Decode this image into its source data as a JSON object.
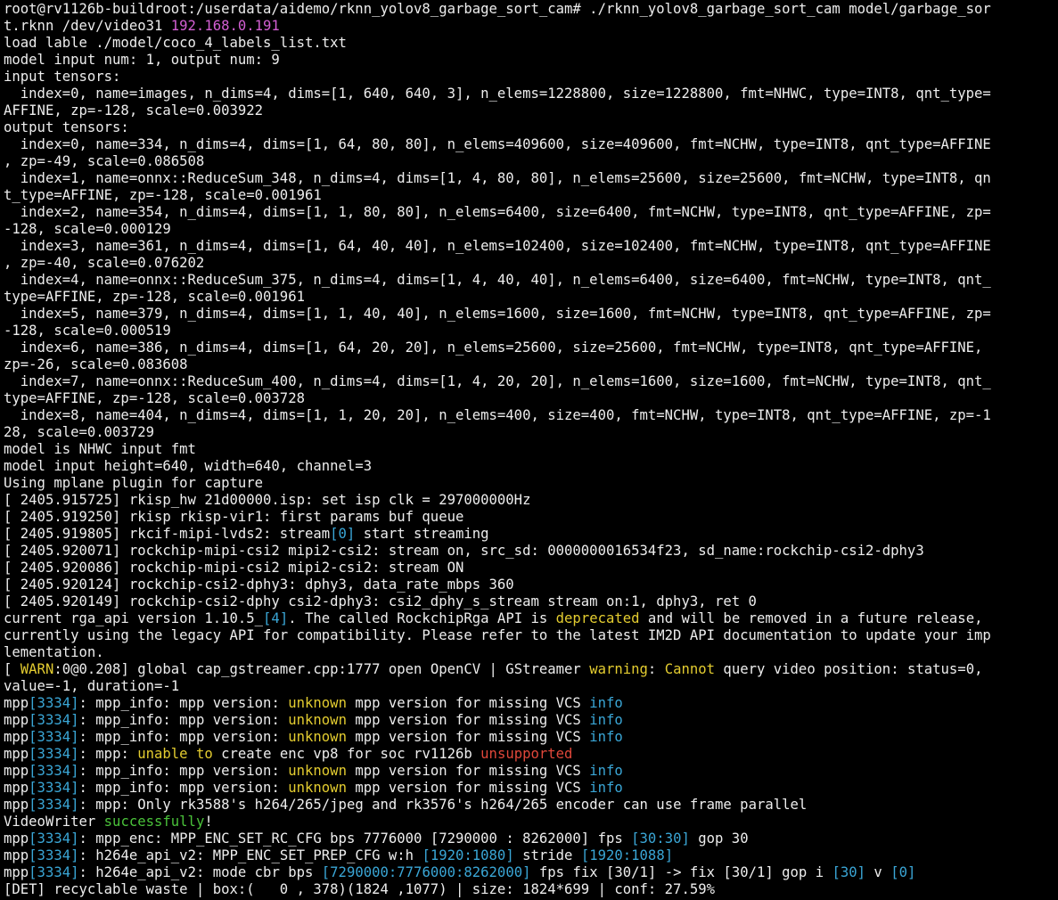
{
  "terminal": {
    "lines": [
      [
        {
          "t": "root@rv1126b-buildroot:/userdata/aidemo/rknn_yolov8_garbage_sort_cam# ./rknn_yolov8_garbage_sort_cam model/garbage_sor"
        }
      ],
      [
        {
          "t": "t.rknn /dev/video31 "
        },
        {
          "t": "192.168.0.191",
          "c": "magenta"
        }
      ],
      [
        {
          "t": "load lable ./model/coco_4_labels_list.txt"
        }
      ],
      [
        {
          "t": "model input num: 1, output num: 9"
        }
      ],
      [
        {
          "t": "input tensors:"
        }
      ],
      [
        {
          "t": "  index=0, name=images, n_dims=4, dims=[1, 640, 640, 3], n_elems=1228800, size=1228800, fmt=NHWC, type=INT8, qnt_type="
        }
      ],
      [
        {
          "t": "AFFINE, zp=-128, scale=0.003922"
        }
      ],
      [
        {
          "t": "output tensors:"
        }
      ],
      [
        {
          "t": "  index=0, name=334, n_dims=4, dims=[1, 64, 80, 80], n_elems=409600, size=409600, fmt=NCHW, type=INT8, qnt_type=AFFINE"
        }
      ],
      [
        {
          "t": ", zp=-49, scale=0.086508"
        }
      ],
      [
        {
          "t": "  index=1, name=onnx::ReduceSum_348, n_dims=4, dims=[1, 4, 80, 80], n_elems=25600, size=25600, fmt=NCHW, type=INT8, qn"
        }
      ],
      [
        {
          "t": "t_type=AFFINE, zp=-128, scale=0.001961"
        }
      ],
      [
        {
          "t": "  index=2, name=354, n_dims=4, dims=[1, 1, 80, 80], n_elems=6400, size=6400, fmt=NCHW, type=INT8, qnt_type=AFFINE, zp="
        }
      ],
      [
        {
          "t": "-128, scale=0.000129"
        }
      ],
      [
        {
          "t": "  index=3, name=361, n_dims=4, dims=[1, 64, 40, 40], n_elems=102400, size=102400, fmt=NCHW, type=INT8, qnt_type=AFFINE"
        }
      ],
      [
        {
          "t": ", zp=-40, scale=0.076202"
        }
      ],
      [
        {
          "t": "  index=4, name=onnx::ReduceSum_375, n_dims=4, dims=[1, 4, 40, 40], n_elems=6400, size=6400, fmt=NCHW, type=INT8, qnt_"
        }
      ],
      [
        {
          "t": "type=AFFINE, zp=-128, scale=0.001961"
        }
      ],
      [
        {
          "t": "  index=5, name=379, n_dims=4, dims=[1, 1, 40, 40], n_elems=1600, size=1600, fmt=NCHW, type=INT8, qnt_type=AFFINE, zp="
        }
      ],
      [
        {
          "t": "-128, scale=0.000519"
        }
      ],
      [
        {
          "t": "  index=6, name=386, n_dims=4, dims=[1, 64, 20, 20], n_elems=25600, size=25600, fmt=NCHW, type=INT8, qnt_type=AFFINE,"
        }
      ],
      [
        {
          "t": "zp=-26, scale=0.083608"
        }
      ],
      [
        {
          "t": "  index=7, name=onnx::ReduceSum_400, n_dims=4, dims=[1, 4, 20, 20], n_elems=1600, size=1600, fmt=NCHW, type=INT8, qnt_"
        }
      ],
      [
        {
          "t": "type=AFFINE, zp=-128, scale=0.003728"
        }
      ],
      [
        {
          "t": "  index=8, name=404, n_dims=4, dims=[1, 1, 20, 20], n_elems=400, size=400, fmt=NCHW, type=INT8, qnt_type=AFFINE, zp=-1"
        }
      ],
      [
        {
          "t": "28, scale=0.003729"
        }
      ],
      [
        {
          "t": "model is NHWC input fmt"
        }
      ],
      [
        {
          "t": "model input height=640, width=640, channel=3"
        }
      ],
      [
        {
          "t": "Using mplane plugin for capture"
        }
      ],
      [
        {
          "t": "[ 2405.915725] rkisp_hw 21d00000.isp: set isp clk = 297000000Hz"
        }
      ],
      [
        {
          "t": "[ 2405.919250] rkisp rkisp-vir1: first params buf queue"
        }
      ],
      [
        {
          "t": "[ 2405.919805] rkcif-mipi-lvds2: stream"
        },
        {
          "t": "[0]",
          "c": "cyan"
        },
        {
          "t": " start streaming"
        }
      ],
      [
        {
          "t": "[ 2405.920071] rockchip-mipi-csi2 mipi2-csi2: stream on, src_sd: 0000000016534f23, sd_name:rockchip-csi2-dphy3"
        }
      ],
      [
        {
          "t": "[ 2405.920086] rockchip-mipi-csi2 mipi2-csi2: stream ON"
        }
      ],
      [
        {
          "t": "[ 2405.920124] rockchip-csi2-dphy3: dphy3, data_rate_mbps 360"
        }
      ],
      [
        {
          "t": "[ 2405.920149] rockchip-csi2-dphy csi2-dphy3: csi2_dphy_s_stream stream on:1, dphy3, ret 0"
        }
      ],
      [
        {
          "t": "current rga_api version 1.10.5_"
        },
        {
          "t": "[4]",
          "c": "cyan"
        },
        {
          "t": ". The called RockchipRga API is "
        },
        {
          "t": "deprecated",
          "c": "yellow"
        },
        {
          "t": " and will be removed in a future release,"
        }
      ],
      [
        {
          "t": "currently using the legacy API for compatibility. Please refer to the latest IM2D API documentation to update your imp"
        }
      ],
      [
        {
          "t": "lementation."
        }
      ],
      [
        {
          "t": "[ "
        },
        {
          "t": "WARN",
          "c": "yellow"
        },
        {
          "t": ":0@0.208] global cap_gstreamer.cpp:1777 open OpenCV | GStreamer "
        },
        {
          "t": "warning",
          "c": "yellow"
        },
        {
          "t": ": "
        },
        {
          "t": "Cannot",
          "c": "yellow"
        },
        {
          "t": " query video position: status=0,"
        }
      ],
      [
        {
          "t": "value=-1, duration=-1"
        }
      ],
      [
        {
          "t": "mpp"
        },
        {
          "t": "[3334]",
          "c": "cyan"
        },
        {
          "t": ": mpp_info: mpp version: "
        },
        {
          "t": "unknown",
          "c": "yellow"
        },
        {
          "t": " mpp version for missing VCS "
        },
        {
          "t": "info",
          "c": "cyan"
        }
      ],
      [
        {
          "t": "mpp"
        },
        {
          "t": "[3334]",
          "c": "cyan"
        },
        {
          "t": ": mpp_info: mpp version: "
        },
        {
          "t": "unknown",
          "c": "yellow"
        },
        {
          "t": " mpp version for missing VCS "
        },
        {
          "t": "info",
          "c": "cyan"
        }
      ],
      [
        {
          "t": "mpp"
        },
        {
          "t": "[3334]",
          "c": "cyan"
        },
        {
          "t": ": mpp_info: mpp version: "
        },
        {
          "t": "unknown",
          "c": "yellow"
        },
        {
          "t": " mpp version for missing VCS "
        },
        {
          "t": "info",
          "c": "cyan"
        }
      ],
      [
        {
          "t": "mpp"
        },
        {
          "t": "[3334]",
          "c": "cyan"
        },
        {
          "t": ": mpp: "
        },
        {
          "t": "unable to",
          "c": "yellow"
        },
        {
          "t": " create enc vp8 for soc rv1126b "
        },
        {
          "t": "unsupported",
          "c": "red"
        }
      ],
      [
        {
          "t": "mpp"
        },
        {
          "t": "[3334]",
          "c": "cyan"
        },
        {
          "t": ": mpp_info: mpp version: "
        },
        {
          "t": "unknown",
          "c": "yellow"
        },
        {
          "t": " mpp version for missing VCS "
        },
        {
          "t": "info",
          "c": "cyan"
        }
      ],
      [
        {
          "t": "mpp"
        },
        {
          "t": "[3334]",
          "c": "cyan"
        },
        {
          "t": ": mpp_info: mpp version: "
        },
        {
          "t": "unknown",
          "c": "yellow"
        },
        {
          "t": " mpp version for missing VCS "
        },
        {
          "t": "info",
          "c": "cyan"
        }
      ],
      [
        {
          "t": "mpp"
        },
        {
          "t": "[3334]",
          "c": "cyan"
        },
        {
          "t": ": mpp: Only rk3588's h264/265/jpeg and rk3576's h264/265 encoder can use frame parallel"
        }
      ],
      [
        {
          "t": "VideoWriter "
        },
        {
          "t": "successfully",
          "c": "green"
        },
        {
          "t": "!"
        }
      ],
      [
        {
          "t": "mpp"
        },
        {
          "t": "[3334]",
          "c": "cyan"
        },
        {
          "t": ": mpp_enc: MPP_ENC_SET_RC_CFG bps 7776000 [7290000 : 8262000] fps "
        },
        {
          "t": "[30:30]",
          "c": "cyan"
        },
        {
          "t": " gop 30"
        }
      ],
      [
        {
          "t": "mpp"
        },
        {
          "t": "[3334]",
          "c": "cyan"
        },
        {
          "t": ": h264e_api_v2: MPP_ENC_SET_PREP_CFG w:h "
        },
        {
          "t": "[1920:1080]",
          "c": "cyan"
        },
        {
          "t": " stride "
        },
        {
          "t": "[1920:1088]",
          "c": "cyan"
        }
      ],
      [
        {
          "t": "mpp"
        },
        {
          "t": "[3334]",
          "c": "cyan"
        },
        {
          "t": ": h264e_api_v2: mode cbr bps "
        },
        {
          "t": "[7290000:7776000:8262000]",
          "c": "cyan"
        },
        {
          "t": " fps fix [30/1] -> fix [30/1] gop i "
        },
        {
          "t": "[30]",
          "c": "cyan"
        },
        {
          "t": " v "
        },
        {
          "t": "[0]",
          "c": "cyan"
        }
      ],
      [
        {
          "t": "[DET] recyclable waste | box:(   0 , 378)(1824 ,1077) | size: 1824*699 | conf: 27.59%"
        }
      ]
    ],
    "colors": {
      "background": "#000000",
      "default": "#ededed",
      "magenta": "#d35fd3",
      "yellow": "#e3cc30",
      "cyan": "#3aa6d6",
      "green": "#4ac23a",
      "red": "#e0473a"
    }
  }
}
